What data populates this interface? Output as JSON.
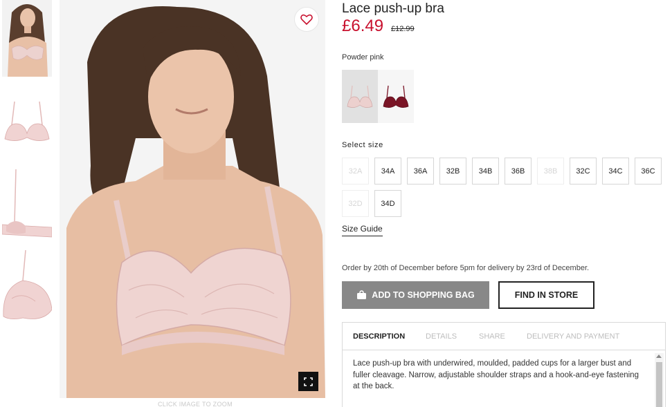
{
  "product": {
    "title": "Lace push-up bra",
    "price": "£6.49",
    "old_price": "£12.99",
    "color_name": "Powder pink",
    "swatches": [
      {
        "name": "Powder pink",
        "color": "#e6c4c3",
        "selected": true
      },
      {
        "name": "Burgundy",
        "color": "#7a1526",
        "selected": false
      }
    ]
  },
  "sizes": {
    "label": "Select size",
    "items": [
      {
        "label": "32A",
        "available": false
      },
      {
        "label": "34A",
        "available": true
      },
      {
        "label": "36A",
        "available": true
      },
      {
        "label": "32B",
        "available": true
      },
      {
        "label": "34B",
        "available": true
      },
      {
        "label": "36B",
        "available": true
      },
      {
        "label": "38B",
        "available": false
      },
      {
        "label": "32C",
        "available": true
      },
      {
        "label": "34C",
        "available": true
      },
      {
        "label": "36C",
        "available": true
      },
      {
        "label": "32D",
        "available": false
      },
      {
        "label": "34D",
        "available": true
      }
    ],
    "guide_label": "Size Guide"
  },
  "delivery_note": "Order by 20th of December before 5pm for delivery by 23rd of December.",
  "buttons": {
    "add_to_bag": "ADD TO SHOPPING BAG",
    "find_in_store": "FIND IN STORE"
  },
  "tabs": [
    {
      "label": "DESCRIPTION",
      "active": true
    },
    {
      "label": "DETAILS",
      "active": false
    },
    {
      "label": "SHARE",
      "active": false
    },
    {
      "label": "DELIVERY AND PAYMENT",
      "active": false
    }
  ],
  "description": "Lace push-up bra with underwired, moulded, padded cups for a larger bust and fuller cleavage. Narrow, adjustable shoulder straps and a hook-and-eye fastening at the back.",
  "gallery": {
    "zoom_hint": "CLICK IMAGE TO ZOOM"
  },
  "icons": {
    "wishlist": "heart-icon",
    "zoom": "fullscreen-icon",
    "bag": "shopping-bag-icon"
  },
  "colors": {
    "price_red": "#c8102e",
    "add_bag_grey": "#888888",
    "product_pink": "#e6c4c3"
  }
}
